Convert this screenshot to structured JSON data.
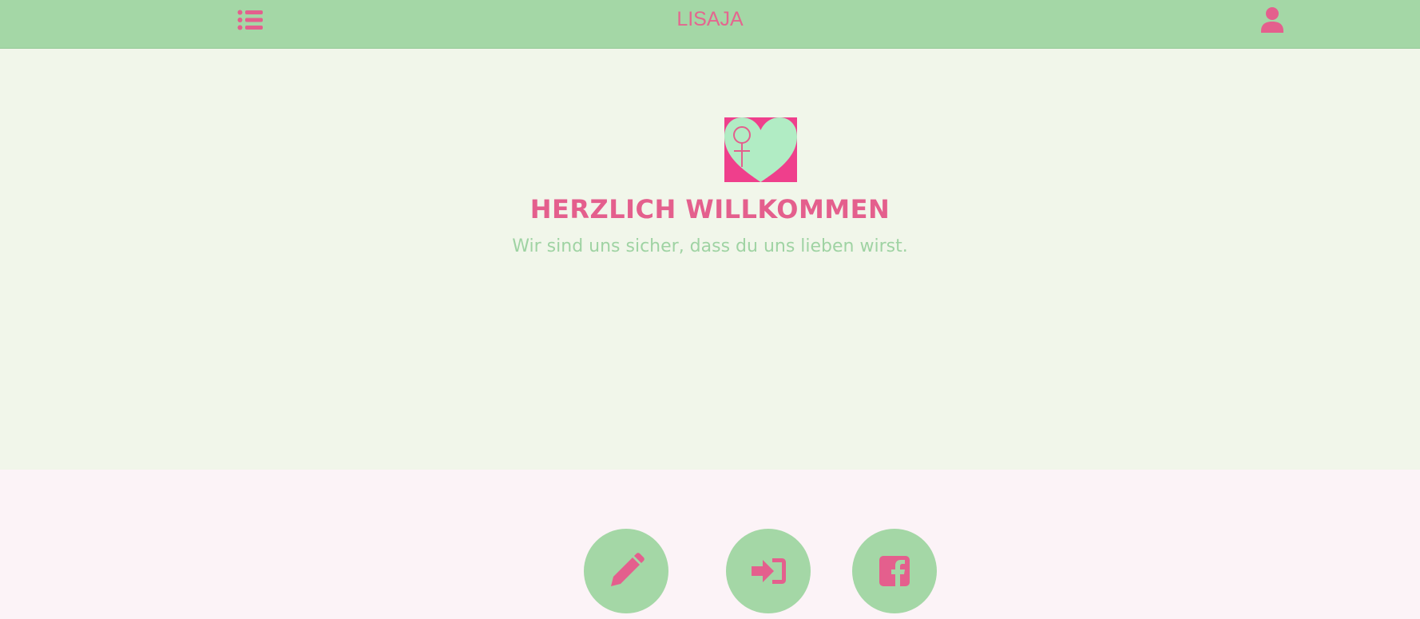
{
  "navbar": {
    "brand": "LISAJA",
    "menu_icon": "list-icon",
    "user_icon": "user-icon"
  },
  "hero": {
    "logo_icon": "heart-female-symbol-logo",
    "headline": "HERZLICH WILLKOMMEN",
    "subline": "Wir sind uns sicher, dass du uns lieben wirst."
  },
  "actions": [
    {
      "icon": "pencil-icon"
    },
    {
      "icon": "sign-in-icon"
    },
    {
      "icon": "facebook-icon"
    }
  ],
  "colors": {
    "navbar_bg": "#a4d7a6",
    "accent_pink": "#e45f8d",
    "hero_bg": "#f1f6ea",
    "footer_bg": "#fcf3f7",
    "subline_green": "#9fd3a3"
  }
}
